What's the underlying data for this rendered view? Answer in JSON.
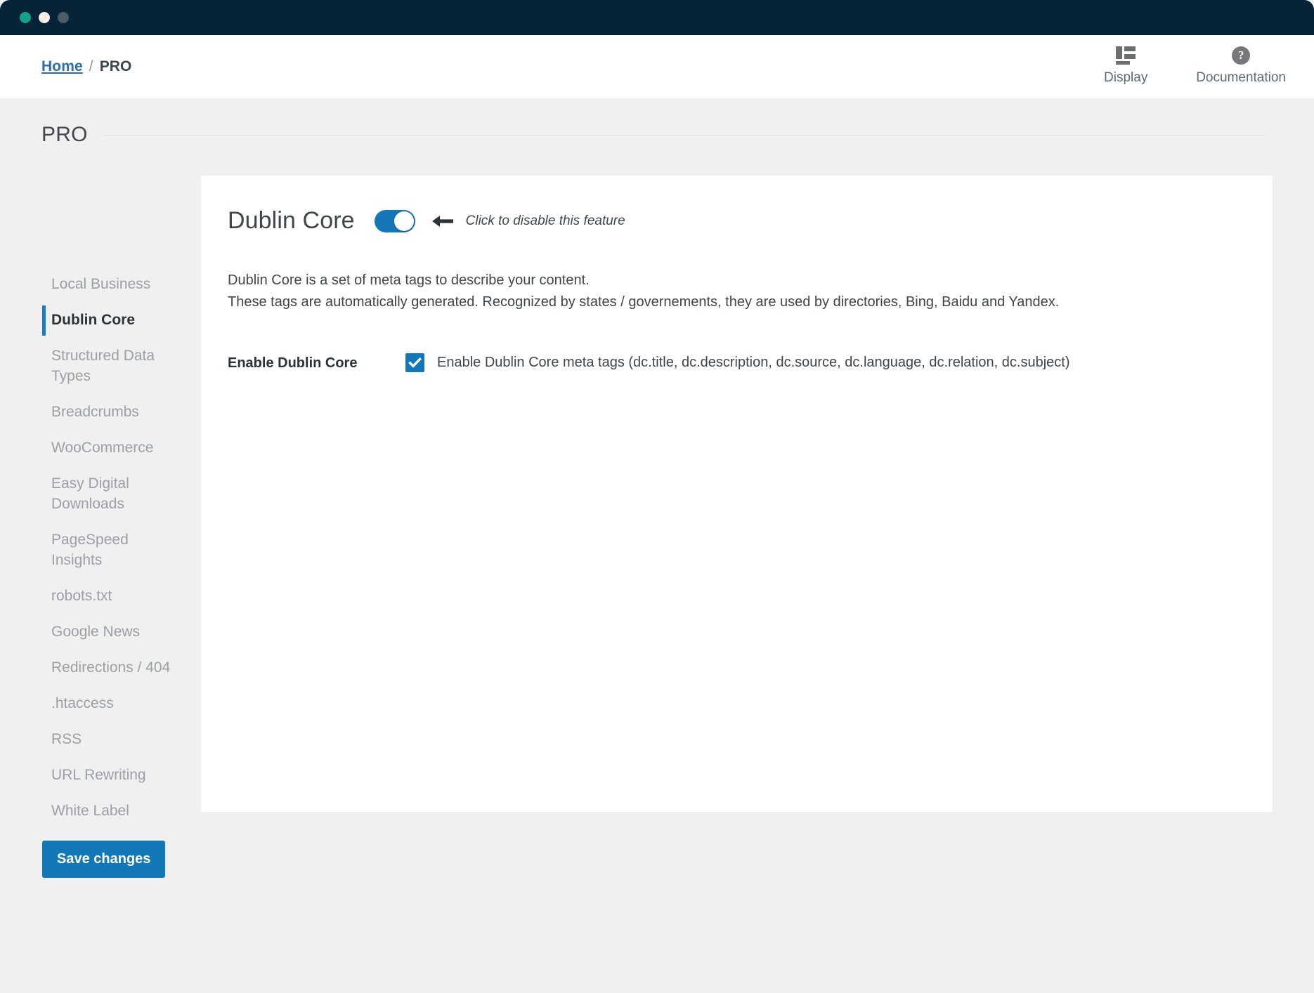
{
  "window": {
    "dots": [
      "close-green",
      "minimize-cream",
      "maximize-gray"
    ]
  },
  "header": {
    "breadcrumb": {
      "home_label": "Home",
      "separator": "/",
      "current_label": "PRO"
    },
    "actions": [
      {
        "label": "Display",
        "icon": "layout-icon"
      },
      {
        "label": "Documentation",
        "icon": "help-circle-icon"
      }
    ]
  },
  "page": {
    "title": "PRO"
  },
  "sidebar": {
    "items": [
      {
        "label": "Local Business",
        "active": false
      },
      {
        "label": "Dublin Core",
        "active": true
      },
      {
        "label": "Structured Data Types",
        "active": false
      },
      {
        "label": "Breadcrumbs",
        "active": false
      },
      {
        "label": "WooCommerce",
        "active": false
      },
      {
        "label": "Easy Digital Downloads",
        "active": false
      },
      {
        "label": "PageSpeed Insights",
        "active": false
      },
      {
        "label": "robots.txt",
        "active": false
      },
      {
        "label": "Google News",
        "active": false
      },
      {
        "label": "Redirections / 404",
        "active": false
      },
      {
        "label": ".htaccess",
        "active": false
      },
      {
        "label": "RSS",
        "active": false
      },
      {
        "label": "URL Rewriting",
        "active": false
      },
      {
        "label": "White Label",
        "active": false
      }
    ],
    "save_label": "Save changes"
  },
  "main": {
    "feature_title": "Dublin Core",
    "toggle_state": "on",
    "toggle_hint": "Click to disable this feature",
    "description_line_1": "Dublin Core is a set of meta tags to describe your content.",
    "description_line_2": "These tags are automatically generated. Recognized by states / governements, they are used by directories, Bing, Baidu and Yandex.",
    "field_label": "Enable Dublin Core",
    "checkbox_checked": true,
    "checkbox_label": "Enable Dublin Core meta tags (dc.title, dc.description, dc.source, dc.language, dc.relation, dc.subject)"
  },
  "colors": {
    "titlebar": "#062338",
    "accent_blue": "#1278b8",
    "toggle_on": "#1577b5",
    "link_blue": "#2e6da9",
    "page_bg": "#f0f0f0"
  }
}
